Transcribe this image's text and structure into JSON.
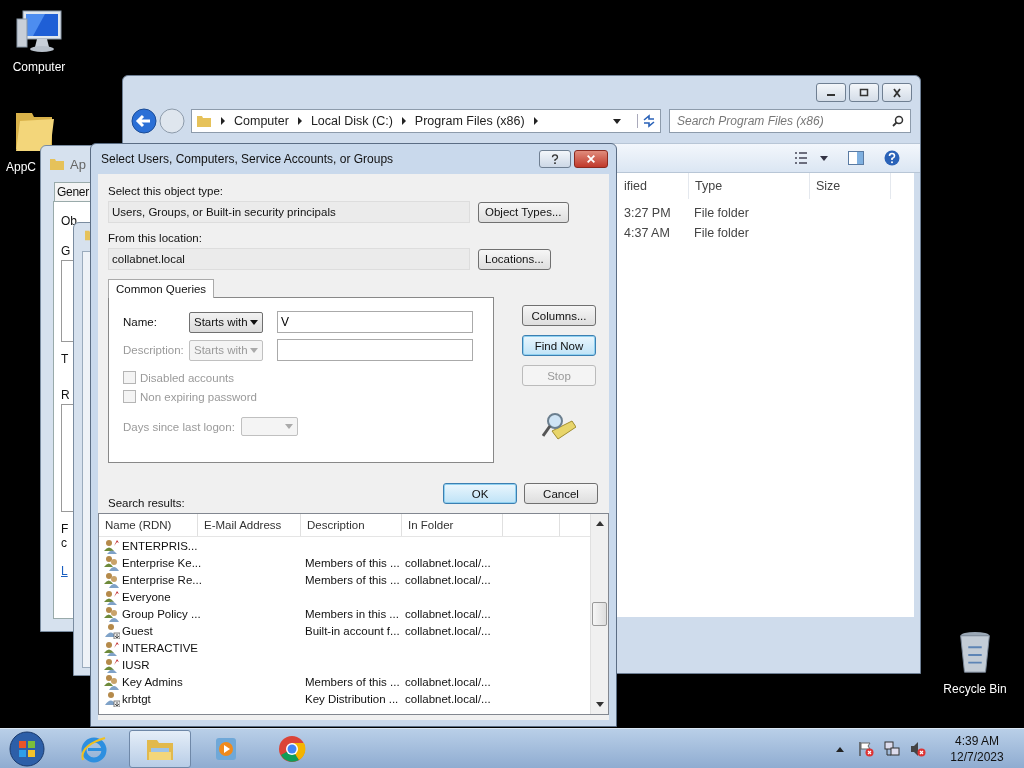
{
  "desktop_icons": [
    {
      "label": "Computer",
      "kind": "computer"
    },
    {
      "label": "AppC",
      "kind": "folder"
    },
    {
      "label": "Recycle Bin",
      "kind": "recycle"
    }
  ],
  "explorer": {
    "breadcrumb": [
      "Computer",
      "Local Disk (C:)",
      "Program Files (x86)"
    ],
    "search": {
      "placeholder": "Search Program Files (x86)"
    },
    "columns": [
      "ified",
      "Type",
      "Size"
    ],
    "rows": [
      [
        "3:27 PM",
        "File folder"
      ],
      [
        "4:37 AM",
        "File folder"
      ]
    ]
  },
  "back_window": {
    "title": "Ap",
    "tab": "Gener",
    "fragments": [
      "Ob",
      "G",
      "T",
      "R",
      "F",
      "c"
    ],
    "link": "L"
  },
  "dialog": {
    "title": "Select Users, Computers, Service Accounts, or Groups",
    "object_type": {
      "label": "Select this object type:",
      "value": "Users, Groups, or Built-in security principals",
      "button": "Object Types..."
    },
    "location": {
      "label": "From this location:",
      "value": "collabnet.local",
      "button": "Locations..."
    },
    "tab": {
      "label": "Common Queries",
      "selected": true
    },
    "queries": [
      {
        "label": "Name:",
        "mode": "Starts with",
        "value": "V",
        "disabled": false
      },
      {
        "label": "Description:",
        "mode": "Starts with",
        "disabled": true
      }
    ],
    "checkboxes": [
      {
        "label": "Disabled accounts",
        "checked": false,
        "disabled": true
      },
      {
        "label": "Non expiring password",
        "checked": false,
        "disabled": true
      }
    ],
    "days": {
      "label": "Days since last logon:",
      "disabled": true
    },
    "side_buttons": [
      {
        "label": "Columns...",
        "default": false,
        "disabled": false
      },
      {
        "label": "Find Now",
        "default": true,
        "disabled": false
      },
      {
        "label": "Stop",
        "default": false,
        "disabled": true
      }
    ],
    "ok": {
      "label": "OK",
      "default": true
    },
    "cancel": {
      "label": "Cancel",
      "default": false
    },
    "results_label": "Search results:",
    "results": {
      "columns": [
        "Name (RDN)",
        "E-Mail Address",
        "Description",
        "In Folder"
      ],
      "rows": [
        {
          "kind": "special",
          "name": "ENTERPRIS..."
        },
        {
          "kind": "group",
          "name": "Enterprise Ke...",
          "description": "Members of this ...",
          "folder": "collabnet.local/..."
        },
        {
          "kind": "group",
          "name": "Enterprise Re...",
          "description": "Members of this ...",
          "folder": "collabnet.local/..."
        },
        {
          "kind": "special",
          "name": "Everyone"
        },
        {
          "kind": "group",
          "name": "Group Policy ...",
          "description": "Members in this ...",
          "folder": "collabnet.local/..."
        },
        {
          "kind": "user",
          "name": "Guest",
          "description": "Built-in account f...",
          "folder": "collabnet.local/..."
        },
        {
          "kind": "special",
          "name": "INTERACTIVE"
        },
        {
          "kind": "special",
          "name": "IUSR"
        },
        {
          "kind": "group",
          "name": "Key Admins",
          "description": "Members of this ...",
          "folder": "collabnet.local/..."
        },
        {
          "kind": "user",
          "name": "krbtgt",
          "description": "Key Distribution ...",
          "folder": "collabnet.local/..."
        }
      ]
    }
  },
  "taskbar": {
    "apps": [
      {
        "kind": "ie",
        "selected": false
      },
      {
        "kind": "explorer",
        "selected": true
      },
      {
        "kind": "media",
        "selected": false
      },
      {
        "kind": "chrome",
        "selected": false
      }
    ],
    "tray": [
      {
        "kind": "flag"
      },
      {
        "kind": "network"
      },
      {
        "kind": "volume"
      }
    ],
    "time": "4:39 AM",
    "date": "12/7/2023"
  }
}
